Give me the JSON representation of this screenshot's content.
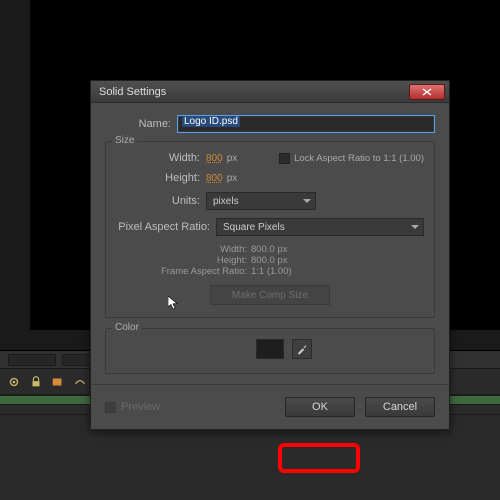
{
  "dialog": {
    "title": "Solid Settings",
    "name_label": "Name:",
    "name_value": "Logo ID.psd",
    "size_legend": "Size",
    "width_label": "Width:",
    "width_value": "800",
    "height_label": "Height:",
    "height_value": "800",
    "px_unit": "px",
    "lock_ar_label": "Lock Aspect Ratio to 1:1 (1.00)",
    "units_label": "Units:",
    "units_value": "pixels",
    "par_label": "Pixel Aspect Ratio:",
    "par_value": "Square Pixels",
    "info_width_label": "Width:",
    "info_width_value": "800.0 px",
    "info_height_label": "Height:",
    "info_height_value": "800.0 px",
    "info_far_label": "Frame Aspect Ratio:",
    "info_far_value": "1:1 (1.00)",
    "make_comp_label": "Make Comp Size",
    "color_legend": "Color",
    "preview_label": "Preview",
    "ok_label": "OK",
    "cancel_label": "Cancel"
  }
}
